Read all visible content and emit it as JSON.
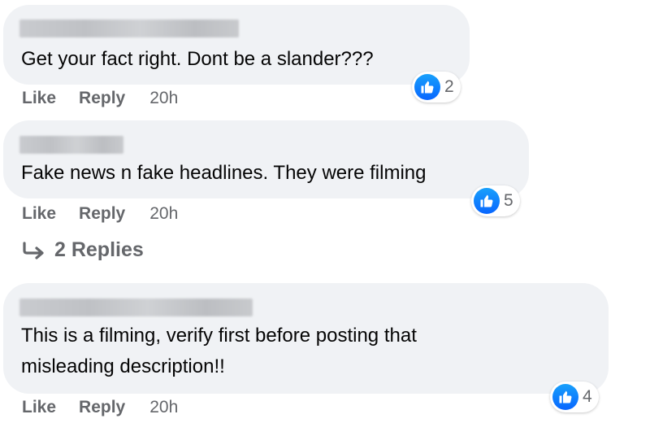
{
  "comments": [
    {
      "text": "Get your fact right. Dont be a slander???",
      "reactions": "2",
      "actions": {
        "like": "Like",
        "reply": "Reply",
        "time": "20h"
      }
    },
    {
      "text": "Fake news n fake headlines. They were filming",
      "reactions": "5",
      "actions": {
        "like": "Like",
        "reply": "Reply",
        "time": "20h"
      }
    },
    {
      "text": "This is a filming, verify first before posting that\nmisleading description!!",
      "reactions": "4",
      "actions": {
        "like": "Like",
        "reply": "Reply",
        "time": "20h"
      }
    }
  ],
  "replies_link": {
    "label": "2 Replies",
    "icon": "reply-arrow-icon"
  },
  "colors": {
    "bubble": "#f0f2f5",
    "text": "#050505",
    "secondary_text": "#65676b",
    "like_blue": "#0866ff"
  }
}
